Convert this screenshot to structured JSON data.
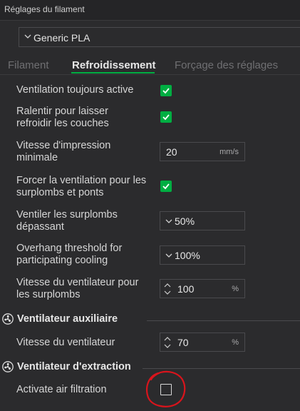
{
  "window": {
    "title": "Réglages du filament"
  },
  "preset": {
    "value": "Generic PLA"
  },
  "tabs": [
    {
      "label": "Filament",
      "active": false
    },
    {
      "label": "Refroidissement",
      "active": true
    },
    {
      "label": "Forçage des réglages",
      "active": false
    }
  ],
  "settings": {
    "fan_always_on": {
      "label": "Ventilation toujours active",
      "checked": true
    },
    "slow_down": {
      "label_line1": "Ralentir pour laisser",
      "label_line2": "refroidir les couches",
      "checked": true
    },
    "min_speed": {
      "label_line1": "Vitesse d'impression",
      "label_line2": "minimale",
      "value": "20",
      "unit": "mm/s"
    },
    "force_cooling": {
      "label_line1": "Forcer la ventilation pour les",
      "label_line2": "surplombs et ponts",
      "checked": true
    },
    "overhang_cooling": {
      "label_line1": "Ventiler les surplombs",
      "label_line2": "dépassant",
      "value": "50%"
    },
    "overhang_threshold": {
      "label_line1": "Overhang threshold for",
      "label_line2": "participating cooling",
      "value": "100%"
    },
    "overhang_fan_speed": {
      "label_line1": "Vitesse du ventilateur pour",
      "label_line2": "les surplombs",
      "value": "100",
      "unit": "%"
    }
  },
  "aux_fan": {
    "title": "Ventilateur auxiliaire",
    "speed": {
      "label": "Vitesse du ventilateur",
      "value": "70",
      "unit": "%"
    }
  },
  "exhaust_fan": {
    "title": "Ventilateur d'extraction",
    "air_filtration": {
      "label": "Activate air filtration",
      "checked": false
    }
  },
  "colors": {
    "accent": "#00ae42",
    "annotation": "#d9141c",
    "background": "#2b2b2d"
  },
  "icons": {
    "fan": "fan-icon",
    "dropdown": "chevron-down-icon",
    "spin": "spin-arrows-icon",
    "check": "check-icon"
  }
}
